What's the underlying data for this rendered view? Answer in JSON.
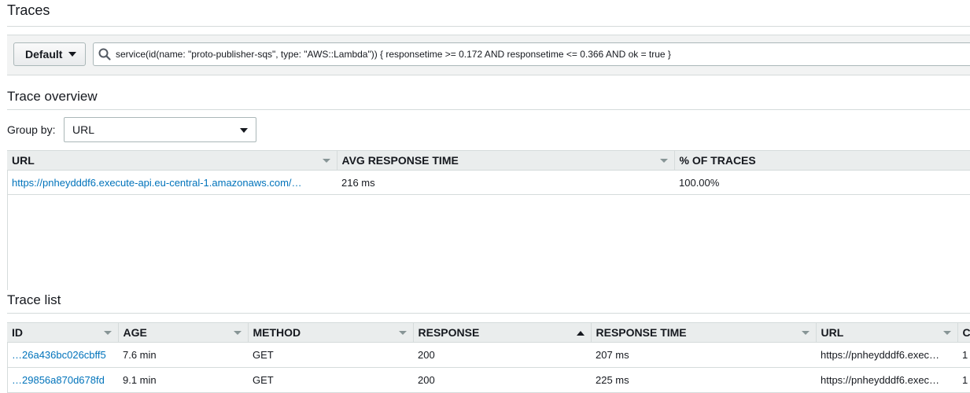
{
  "page": {
    "title": "Traces"
  },
  "filter": {
    "group_button": "Default",
    "query": "service(id(name: \"proto-publisher-sqs\", type: \"AWS::Lambda\")) { responsetime >= 0.172 AND responsetime <= 0.366 AND ok = true }"
  },
  "overview": {
    "title": "Trace overview",
    "group_by_label": "Group by:",
    "group_by_value": "URL",
    "columns": [
      "URL",
      "AVG RESPONSE TIME",
      "% OF TRACES"
    ],
    "rows": [
      {
        "url": "https://pnheydddf6.execute-api.eu-central-1.amazonaws.com/…",
        "avg": "216 ms",
        "pct": "100.00%"
      }
    ]
  },
  "trace_list": {
    "title": "Trace list",
    "columns": [
      "ID",
      "AGE",
      "METHOD",
      "RESPONSE",
      "RESPONSE TIME",
      "URL",
      "C"
    ],
    "rows": [
      {
        "id": "…26a436bc026cbff5",
        "age": "7.6 min",
        "method": "GET",
        "response": "200",
        "time": "207 ms",
        "url": "https://pnheydddf6.exec…",
        "extra": "1"
      },
      {
        "id": "…29856a870d678fd",
        "age": "9.1 min",
        "method": "GET",
        "response": "200",
        "time": "225 ms",
        "url": "https://pnheydddf6.exec…",
        "extra": "1"
      }
    ]
  },
  "colors": {
    "link": "#0073bb",
    "header_bg": "#eaeded",
    "border": "#d5dbdb"
  }
}
